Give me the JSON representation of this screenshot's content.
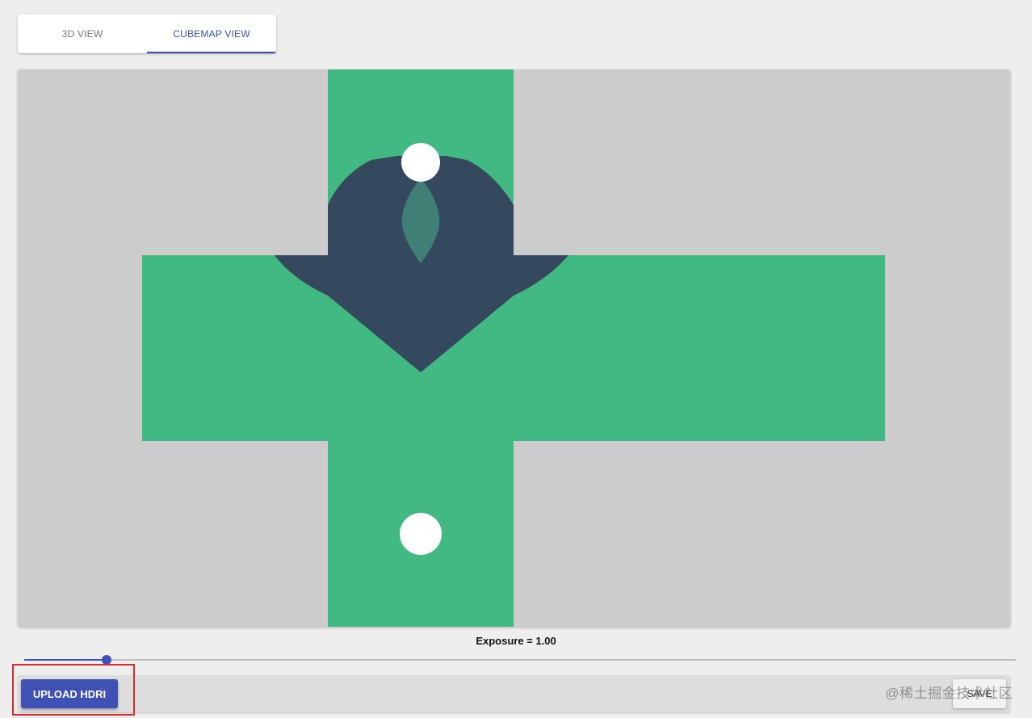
{
  "tabs": [
    {
      "label": "3D VIEW",
      "active": false
    },
    {
      "label": "CUBEMAP VIEW",
      "active": true
    }
  ],
  "exposure": {
    "label": "Exposure = 1.00",
    "slider_value": 1.0,
    "slider_fraction": 0.083
  },
  "toolbar": {
    "upload_label": "UPLOAD HDRI",
    "save_label": "SAVE"
  },
  "watermark": "@稀土掘金技术社区",
  "colors": {
    "accent": "#3f51b5",
    "cube_face_green": "#42b983",
    "cube_shape_dark": "#35495e",
    "viewer_bg": "#cccccc",
    "annotation_red": "#e0292b"
  }
}
